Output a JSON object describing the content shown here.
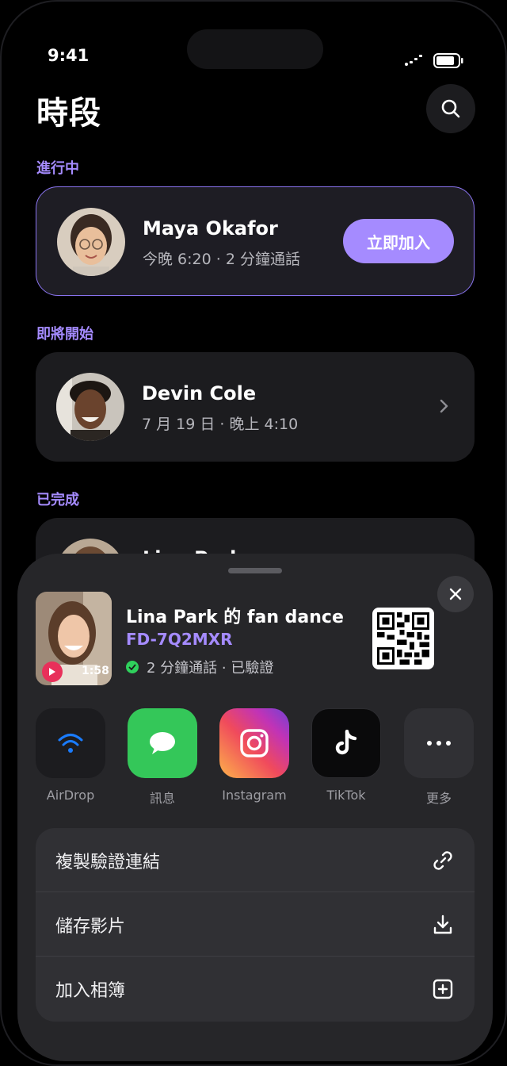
{
  "status_bar": {
    "time": "9:41"
  },
  "header": {
    "title": "時段"
  },
  "sections": {
    "live": "進行中",
    "upcoming": "即將開始",
    "completed": "已完成"
  },
  "live_card": {
    "name": "Maya Okafor",
    "subtitle": "今晚 6:20 · 2 分鐘通話",
    "join_label": "立即加入"
  },
  "upcoming_card": {
    "name": "Devin Cole",
    "subtitle": "7 月 19 日 · 晚上 4:10"
  },
  "completed_card": {
    "name": "Lina Park"
  },
  "share_sheet": {
    "title": "Lina Park 的 fan dance",
    "code": "FD-7Q2MXR",
    "meta": "2 分鐘通話 · 已驗證",
    "video_duration": "1:58",
    "apps": [
      {
        "label": "AirDrop",
        "icon": "airdrop-icon"
      },
      {
        "label": "訊息",
        "icon": "messages-icon"
      },
      {
        "label": "Instagram",
        "icon": "instagram-icon"
      },
      {
        "label": "TikTok",
        "icon": "tiktok-icon"
      },
      {
        "label": "更多",
        "icon": "more-icon"
      }
    ],
    "actions": [
      {
        "label": "複製驗證連結",
        "icon": "link-icon"
      },
      {
        "label": "儲存影片",
        "icon": "download-icon"
      },
      {
        "label": "加入相簿",
        "icon": "add-album-icon"
      }
    ]
  },
  "colors": {
    "accent": "#a58bff",
    "verified": "#2fd05c",
    "play": "#e8305a"
  }
}
